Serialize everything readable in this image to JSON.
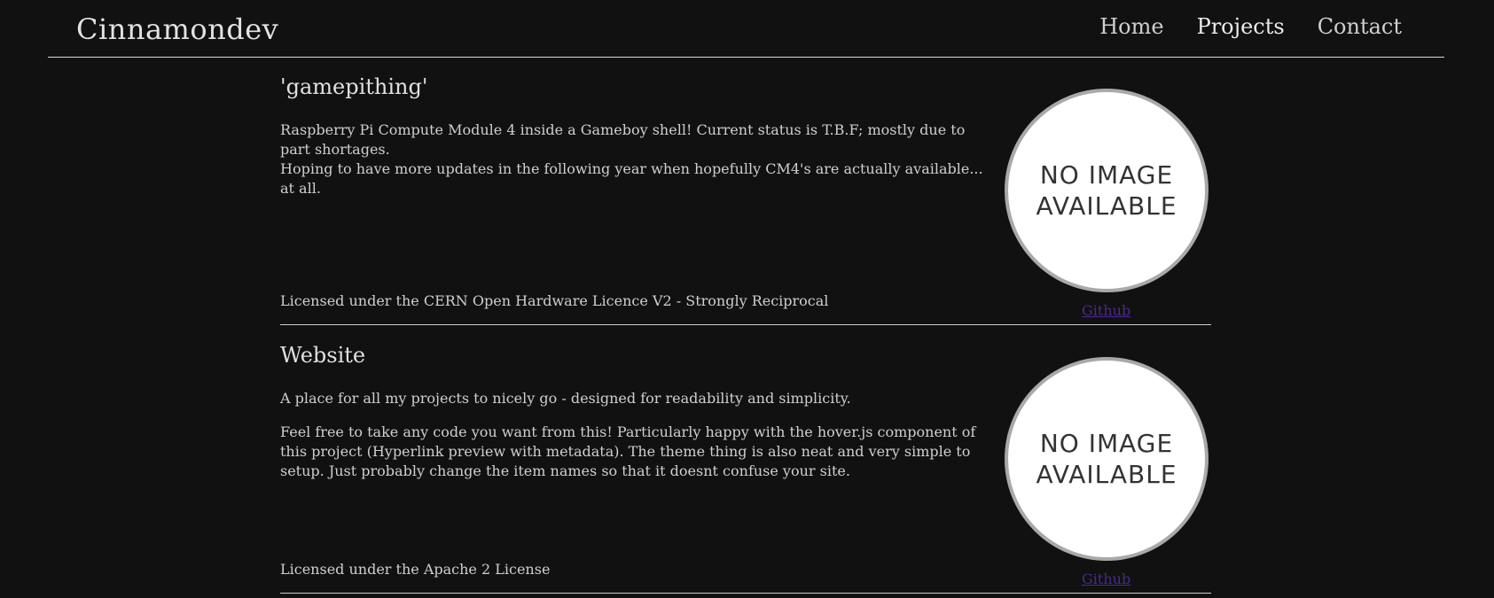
{
  "header": {
    "site_title": "Cinnamondev",
    "nav": [
      {
        "label": "Home"
      },
      {
        "label": "Projects"
      },
      {
        "label": "Contact"
      }
    ]
  },
  "projects": [
    {
      "title": "'gamepithing'",
      "description": [
        "Raspberry Pi Compute Module 4 inside a Gameboy shell! Current status is T.B.F; mostly due to part shortages.\nHoping to have more updates in the following year when hopefully CM4's are actually available... at all."
      ],
      "license": "Licensed under the CERN Open Hardware Licence V2 - Strongly Reciprocal",
      "image_text": "NO IMAGE\nAVAILABLE",
      "link_label": "Github"
    },
    {
      "title": "Website",
      "description": [
        "A place for all my projects to nicely go - designed for readability and simplicity.",
        "Feel free to take any code you want from this! Particularly happy with the hover.js component of this project (Hyperlink preview with metadata). The theme thing is also neat and very simple to setup. Just probably change the item names so that it doesnt confuse your site."
      ],
      "license": "Licensed under the Apache 2 License",
      "image_text": "NO IMAGE\nAVAILABLE",
      "link_label": "Github"
    }
  ],
  "colors": {
    "background": "#111111",
    "text": "#cfcfcf",
    "link": "#4a2a8a",
    "divider": "#cfcfcf"
  }
}
